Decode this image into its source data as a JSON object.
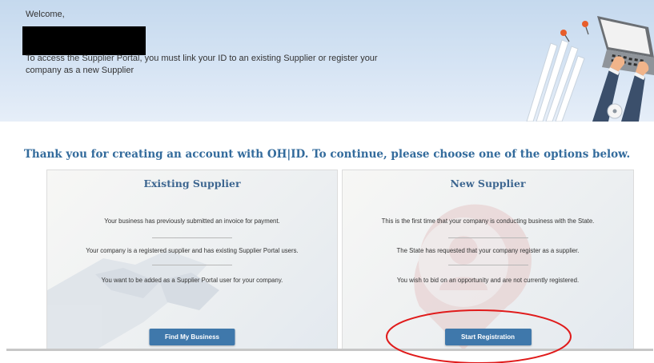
{
  "banner": {
    "welcome": "Welcome,",
    "intro": "To access the Supplier Portal, you must link your ID to an existing Supplier or register your company as a new Supplier"
  },
  "headline": "Thank you for creating an account with OH|ID. To continue, please choose one of the options below.",
  "existing": {
    "title": "Existing Supplier",
    "lines": [
      "Your business has previously submitted an invoice for payment.",
      "Your company is a registered supplier and has existing Supplier Portal users.",
      "You want to be added as a Supplier Portal user for your company."
    ],
    "button": "Find My Business"
  },
  "new": {
    "title": "New Supplier",
    "lines": [
      "This is the first time that your company is conducting business with the State.",
      "The State has requested that your company register as a supplier.",
      "You wish to bid on an opportunity and are not currently registered."
    ],
    "button": "Start Registration"
  },
  "colors": {
    "headline": "#336b9c",
    "button": "#3f78ab",
    "annotation": "#e01b1b"
  },
  "icons": {
    "banner": "laptop-illustration",
    "existing_watermark": "handshake-icon",
    "new_watermark": "map-pin-person-icon"
  }
}
